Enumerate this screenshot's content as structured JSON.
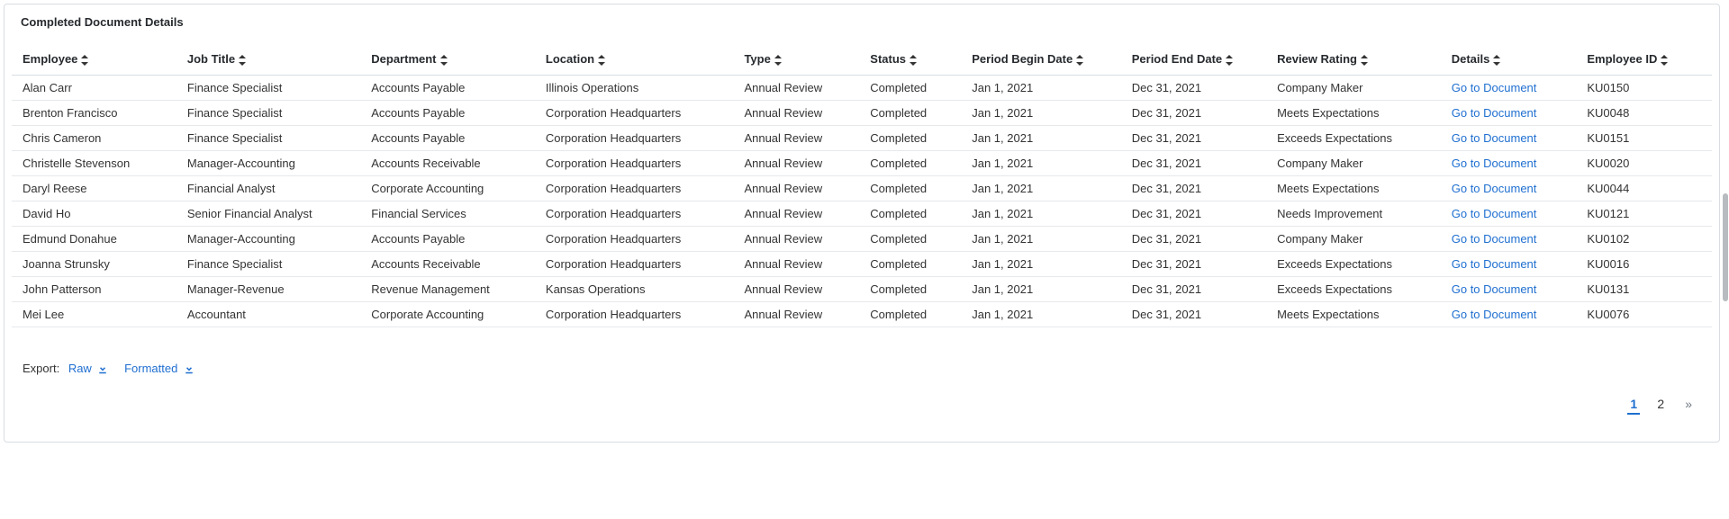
{
  "panel": {
    "title": "Completed Document Details"
  },
  "columns": {
    "employee": "Employee",
    "jobtitle": "Job Title",
    "department": "Department",
    "location": "Location",
    "type": "Type",
    "status": "Status",
    "begin": "Period Begin Date",
    "end": "Period End Date",
    "rating": "Review Rating",
    "details": "Details",
    "empid": "Employee ID"
  },
  "rows": [
    {
      "employee": "Alan Carr",
      "jobtitle": "Finance Specialist",
      "department": "Accounts Payable",
      "location": "Illinois Operations",
      "type": "Annual Review",
      "status": "Completed",
      "begin": "Jan 1, 2021",
      "end": "Dec 31, 2021",
      "rating": "Company Maker",
      "details": "Go to Document",
      "empid": "KU0150"
    },
    {
      "employee": "Brenton Francisco",
      "jobtitle": "Finance Specialist",
      "department": "Accounts Payable",
      "location": "Corporation Headquarters",
      "type": "Annual Review",
      "status": "Completed",
      "begin": "Jan 1, 2021",
      "end": "Dec 31, 2021",
      "rating": "Meets Expectations",
      "details": "Go to Document",
      "empid": "KU0048"
    },
    {
      "employee": "Chris Cameron",
      "jobtitle": "Finance Specialist",
      "department": "Accounts Payable",
      "location": "Corporation Headquarters",
      "type": "Annual Review",
      "status": "Completed",
      "begin": "Jan 1, 2021",
      "end": "Dec 31, 2021",
      "rating": "Exceeds Expectations",
      "details": "Go to Document",
      "empid": "KU0151"
    },
    {
      "employee": "Christelle Stevenson",
      "jobtitle": "Manager-Accounting",
      "department": "Accounts Receivable",
      "location": "Corporation Headquarters",
      "type": "Annual Review",
      "status": "Completed",
      "begin": "Jan 1, 2021",
      "end": "Dec 31, 2021",
      "rating": "Company Maker",
      "details": "Go to Document",
      "empid": "KU0020"
    },
    {
      "employee": "Daryl Reese",
      "jobtitle": "Financial Analyst",
      "department": "Corporate Accounting",
      "location": "Corporation Headquarters",
      "type": "Annual Review",
      "status": "Completed",
      "begin": "Jan 1, 2021",
      "end": "Dec 31, 2021",
      "rating": "Meets Expectations",
      "details": "Go to Document",
      "empid": "KU0044"
    },
    {
      "employee": "David Ho",
      "jobtitle": "Senior Financial Analyst",
      "department": "Financial Services",
      "location": "Corporation Headquarters",
      "type": "Annual Review",
      "status": "Completed",
      "begin": "Jan 1, 2021",
      "end": "Dec 31, 2021",
      "rating": "Needs Improvement",
      "details": "Go to Document",
      "empid": "KU0121"
    },
    {
      "employee": "Edmund Donahue",
      "jobtitle": "Manager-Accounting",
      "department": "Accounts Payable",
      "location": "Corporation Headquarters",
      "type": "Annual Review",
      "status": "Completed",
      "begin": "Jan 1, 2021",
      "end": "Dec 31, 2021",
      "rating": "Company Maker",
      "details": "Go to Document",
      "empid": "KU0102"
    },
    {
      "employee": "Joanna Strunsky",
      "jobtitle": "Finance Specialist",
      "department": "Accounts Receivable",
      "location": "Corporation Headquarters",
      "type": "Annual Review",
      "status": "Completed",
      "begin": "Jan 1, 2021",
      "end": "Dec 31, 2021",
      "rating": "Exceeds Expectations",
      "details": "Go to Document",
      "empid": "KU0016"
    },
    {
      "employee": "John Patterson",
      "jobtitle": "Manager-Revenue",
      "department": "Revenue Management",
      "location": "Kansas Operations",
      "type": "Annual Review",
      "status": "Completed",
      "begin": "Jan 1, 2021",
      "end": "Dec 31, 2021",
      "rating": "Exceeds Expectations",
      "details": "Go to Document",
      "empid": "KU0131"
    },
    {
      "employee": "Mei Lee",
      "jobtitle": "Accountant",
      "department": "Corporate Accounting",
      "location": "Corporation Headquarters",
      "type": "Annual Review",
      "status": "Completed",
      "begin": "Jan 1, 2021",
      "end": "Dec 31, 2021",
      "rating": "Meets Expectations",
      "details": "Go to Document",
      "empid": "KU0076"
    }
  ],
  "export": {
    "label": "Export:",
    "raw": "Raw",
    "formatted": "Formatted"
  },
  "pager": {
    "pages": [
      "1",
      "2"
    ],
    "current": 0,
    "next": "»"
  }
}
